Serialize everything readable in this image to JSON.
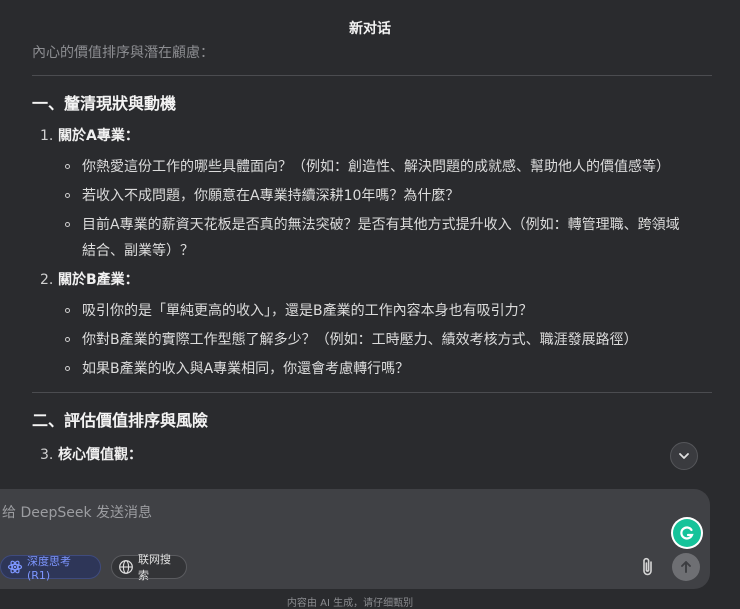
{
  "header": {
    "title": "新对话"
  },
  "content": {
    "faded_intro": "內心的價值排序與潛在顧慮：",
    "sections": [
      {
        "heading": "一、釐清現狀與動機",
        "items": [
          {
            "number": "1.",
            "label": "關於A專業：",
            "bullets": [
              "你熱愛這份工作的哪些具體面向？（例如：創造性、解決問題的成就感、幫助他人的價值感等）",
              "若收入不成問題，你願意在A專業持續深耕10年嗎？為什麼？",
              "目前A專業的薪資天花板是否真的無法突破？是否有其他方式提升收入（例如：轉管理職、跨領域",
              "結合、副業等）？"
            ]
          },
          {
            "number": "2.",
            "label": "關於B產業：",
            "bullets": [
              "吸引你的是「單純更高的收入」，還是B產業的工作內容本身也有吸引力？",
              "你對B產業的實際工作型態了解多少？（例如：工時壓力、績效考核方式、職涯發展路徑）",
              "如果B產業的收入與A專業相同，你還會考慮轉行嗎？"
            ]
          }
        ]
      },
      {
        "heading": "二、評估價值排序與風險",
        "items": [
          {
            "number": "3.",
            "label": "核心價值觀："
          }
        ]
      }
    ]
  },
  "composer": {
    "placeholder": "给 DeepSeek 发送消息",
    "deep_think_label": "深度思考 (R1)",
    "web_search_label": "联网搜索"
  },
  "footer": {
    "note": "内容由 AI 生成，请仔细甄别"
  },
  "colors": {
    "background": "#2a2b2e",
    "composer": "#404145",
    "accent": "#7d96ff",
    "grammarly": "#15c39a"
  }
}
